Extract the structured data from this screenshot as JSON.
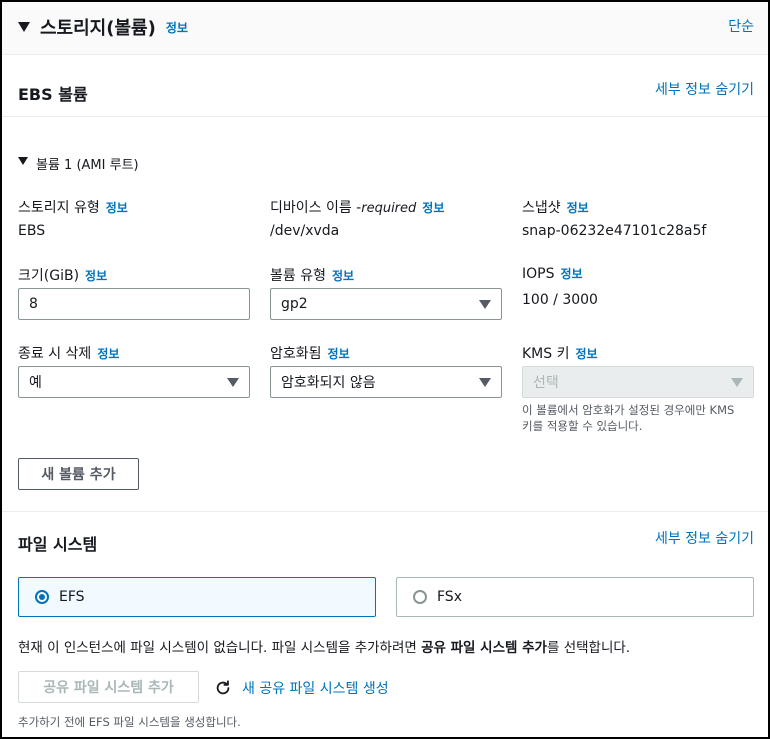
{
  "header": {
    "title": "스토리지(볼륨)",
    "info": "정보",
    "simple_link": "단순"
  },
  "ebs": {
    "title": "EBS 볼륨",
    "hide_details": "세부 정보 숨기기",
    "volume_title": "볼륨 1 (AMI 루트)",
    "storage_type": {
      "label": "스토리지 유형",
      "info": "정보",
      "value": "EBS"
    },
    "device_name": {
      "label": "디바이스 이름 - ",
      "required": "required",
      "info": "정보",
      "value": "/dev/xvda"
    },
    "snapshot": {
      "label": "스냅샷",
      "info": "정보",
      "value": "snap-06232e47101c28a5f"
    },
    "size": {
      "label": "크기(GiB)",
      "info": "정보",
      "value": "8"
    },
    "volume_type": {
      "label": "볼륨 유형",
      "info": "정보",
      "value": "gp2"
    },
    "iops": {
      "label": "IOPS",
      "info": "정보",
      "value": "100 / 3000"
    },
    "delete_on_termination": {
      "label": "종료 시 삭제",
      "info": "정보",
      "value": "예"
    },
    "encrypted": {
      "label": "암호화됨",
      "info": "정보",
      "value": "암호화되지 않음"
    },
    "kms_key": {
      "label": "KMS 키",
      "info": "정보",
      "value": "선택",
      "hint_line1": "이 볼륨에서 암호화가 설정된 경우에만 KMS",
      "hint_line2": "키를 적용할 수 있습니다."
    },
    "add_volume_button": "새 볼륨 추가"
  },
  "file_system": {
    "title": "파일 시스템",
    "hide_details": "세부 정보 숨기기",
    "options": [
      {
        "label": "EFS",
        "selected": true
      },
      {
        "label": "FSx",
        "selected": false
      }
    ],
    "message_prefix": "현재 이 인스턴스에 파일 시스템이 없습니다. 파일 시스템을 추가하려면 ",
    "message_bold": "공유 파일 시스템 추가",
    "message_suffix": "를 선택합니다.",
    "add_shared_button": "공유 파일 시스템 추가",
    "create_new_link": "새 공유 파일 시스템 생성",
    "footer_hint": "추가하기 전에 EFS 파일 시스템을 생성합니다."
  }
}
